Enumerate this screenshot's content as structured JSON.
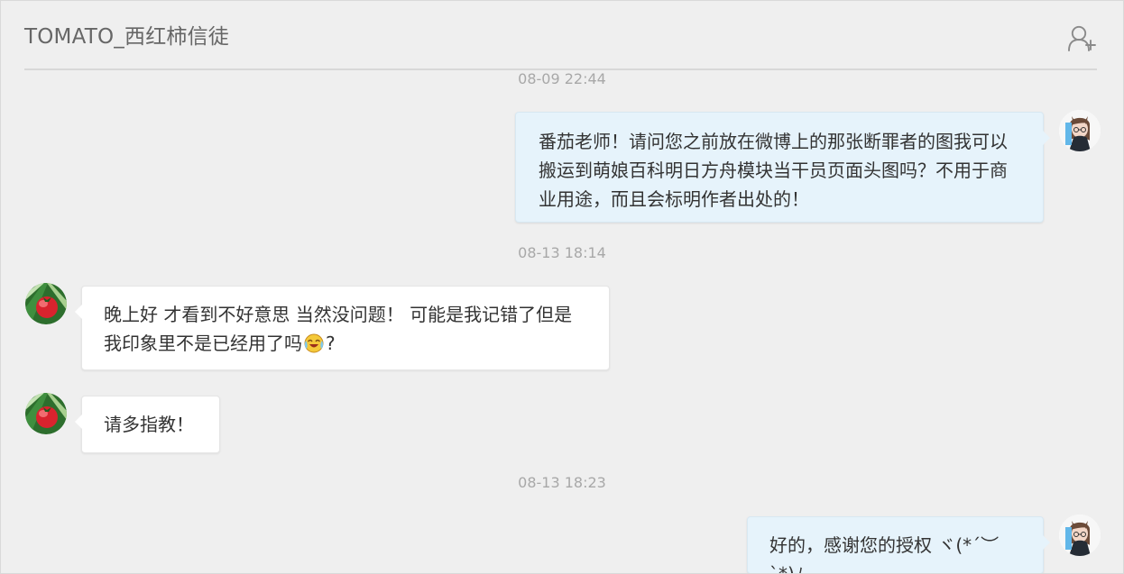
{
  "conversation": {
    "title": "TOMATO_西红柿信徒",
    "add_user_icon": "add-user-icon"
  },
  "messages": [
    {
      "time": "08-09 22:44",
      "side": "me",
      "text": "番茄老师！请问您之前放在微博上的那张断罪者的图我可以搬运到萌娘百科明日方舟模块当干员页面头图吗？不用于商业用途，而且会标明作者出处的！"
    },
    {
      "time": "08-13 18:14",
      "side": "them",
      "text_before": "晚上好 才看到不好意思 当然没问题！ 可能是我记错了但是我印象里不是已经用了吗",
      "emoji": "laughing-crying-emoji",
      "text_after": "?"
    },
    {
      "side": "them",
      "text": "请多指教！"
    },
    {
      "time": "08-13 18:23",
      "side": "me",
      "text": "好的，感谢您的授权 ヾ(*´︶`*)ﾉ"
    }
  ],
  "colors": {
    "background": "#efefef",
    "my_bubble": "#e6f3fb",
    "their_bubble": "#ffffff",
    "timestamp": "#a8a8a8",
    "title": "#666666"
  }
}
